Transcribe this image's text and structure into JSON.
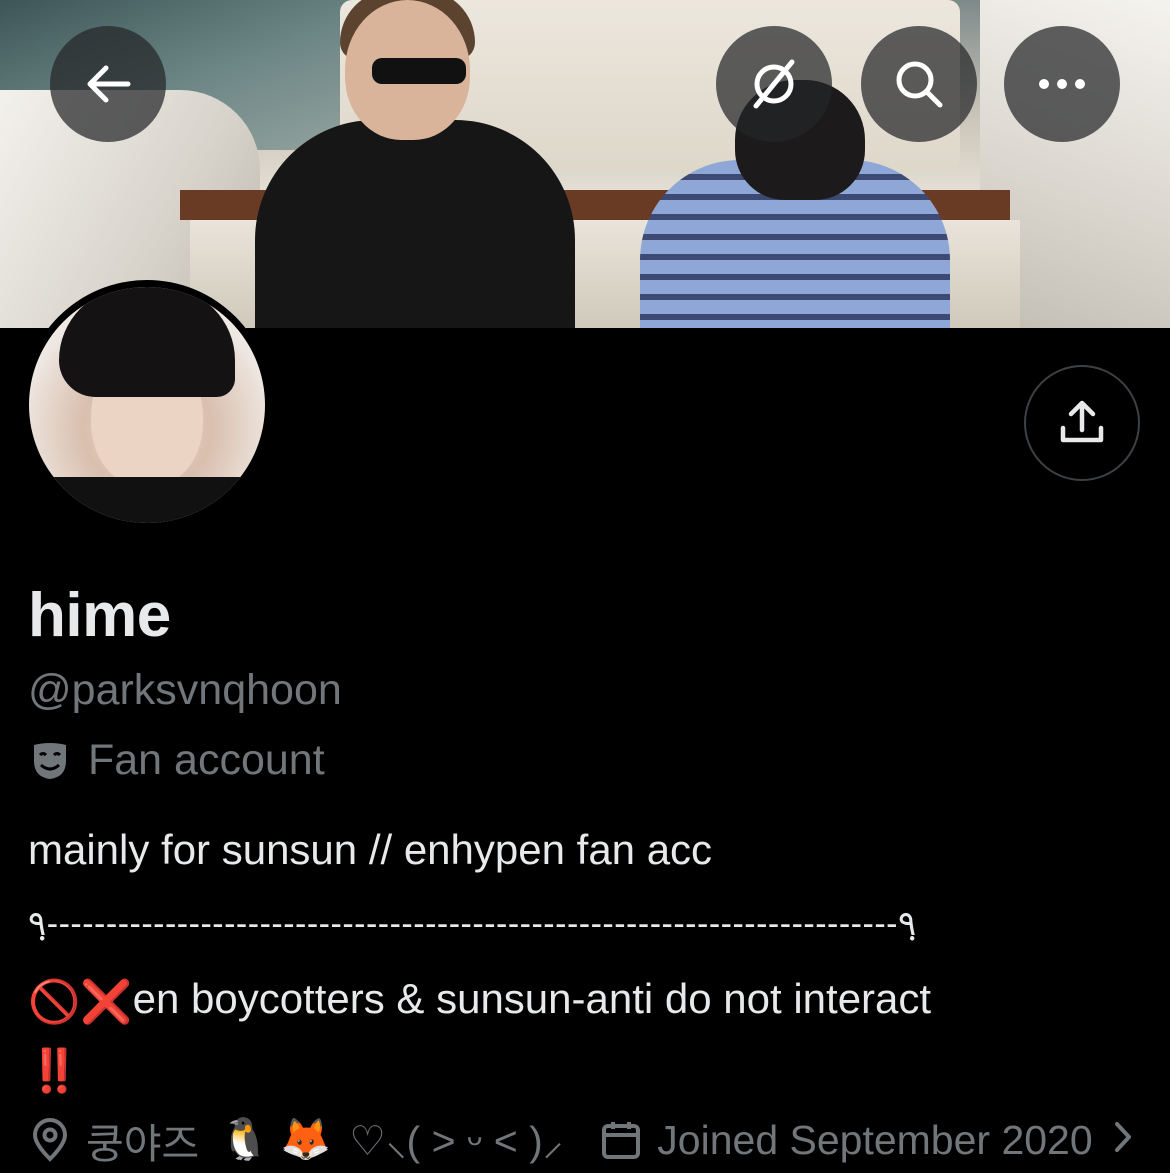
{
  "header": {
    "back_icon": "arrow-left-icon",
    "grok_icon": "slashed-circle-icon",
    "search_icon": "search-icon",
    "more_icon": "more-horizontal-icon"
  },
  "profile": {
    "name": "hime",
    "handle": "@parksvnqhoon",
    "category_icon": "theater-mask-icon",
    "category": "Fan account",
    "bio_line1": "mainly for sunsun // enhypen fan acc",
    "bio_line2": "٩ฺ------------------------------------------------------------------------٩ฺ",
    "bio_line3": "en boycotters & sunsun-anti do not interact",
    "bio_emoji_prefix": "🚫❌",
    "bio_emoji_suffix": "‼️",
    "location": "쿵야즈",
    "location_emojis": [
      "🐧",
      "🦊"
    ],
    "location_kaomoji": "♡⸜( ˃ ᵕ ˂ )⸝",
    "joined": "Joined September 2020"
  },
  "colors": {
    "background": "#000000",
    "text_primary": "#e7e9ea",
    "text_secondary": "#71767b"
  }
}
